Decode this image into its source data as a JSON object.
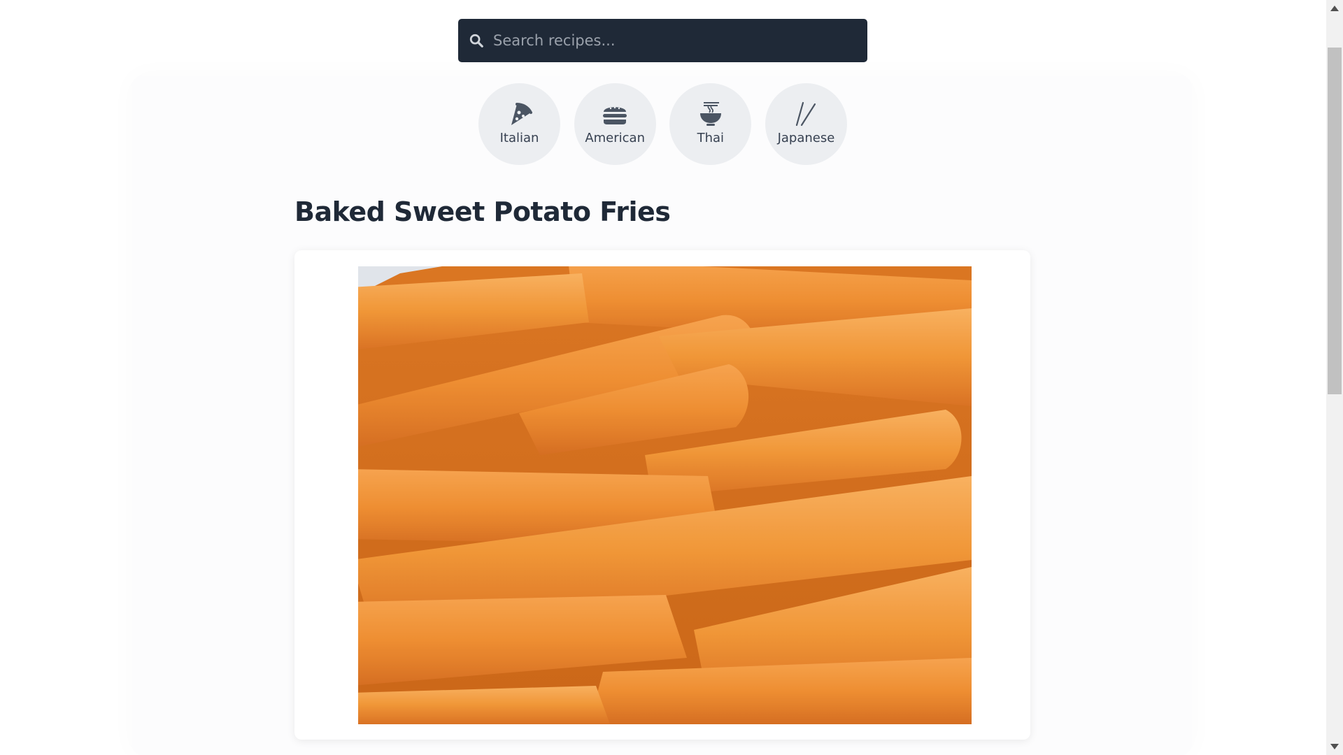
{
  "search": {
    "placeholder": "Search recipes...",
    "icon": "search-icon"
  },
  "cuisines": [
    {
      "label": "Italian",
      "icon": "pizza-icon"
    },
    {
      "label": "American",
      "icon": "burger-icon"
    },
    {
      "label": "Thai",
      "icon": "noodle-bowl-icon"
    },
    {
      "label": "Japanese",
      "icon": "chopsticks-icon"
    }
  ],
  "recipe": {
    "title": "Baked Sweet Potato Fries",
    "image": "sweet-potato-fries-photo"
  },
  "colors": {
    "search_bg": "#1f2937",
    "title": "#1f2937",
    "cuisine_bg": "#eceef1",
    "fries": "#e57a1c"
  }
}
